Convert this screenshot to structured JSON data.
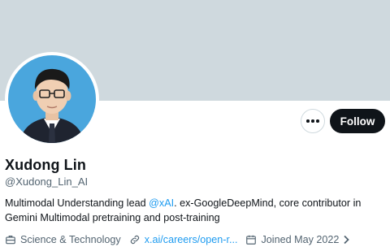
{
  "profile": {
    "name": "Xudong Lin",
    "handle": "@Xudong_Lin_AI",
    "bio_before": "Multimodal Understanding lead ",
    "bio_mention": "@xAI",
    "bio_after": ". ex-GoogleDeepMind, core contributor in Gemini Multimodal pretraining and post-training",
    "category": "Science & Technology",
    "website": "x.ai/careers/open-r...",
    "joined": "Joined May 2022"
  },
  "actions": {
    "follow_label": "Follow",
    "more_label": "More"
  },
  "icons": {
    "category": "briefcase-icon",
    "website": "link-icon",
    "joined": "calendar-icon",
    "more": "ellipsis-icon"
  },
  "colors": {
    "banner": "#cfd9de",
    "accent": "#1d9bf0",
    "follow_bg": "#0f1419",
    "muted_text": "#536471"
  }
}
